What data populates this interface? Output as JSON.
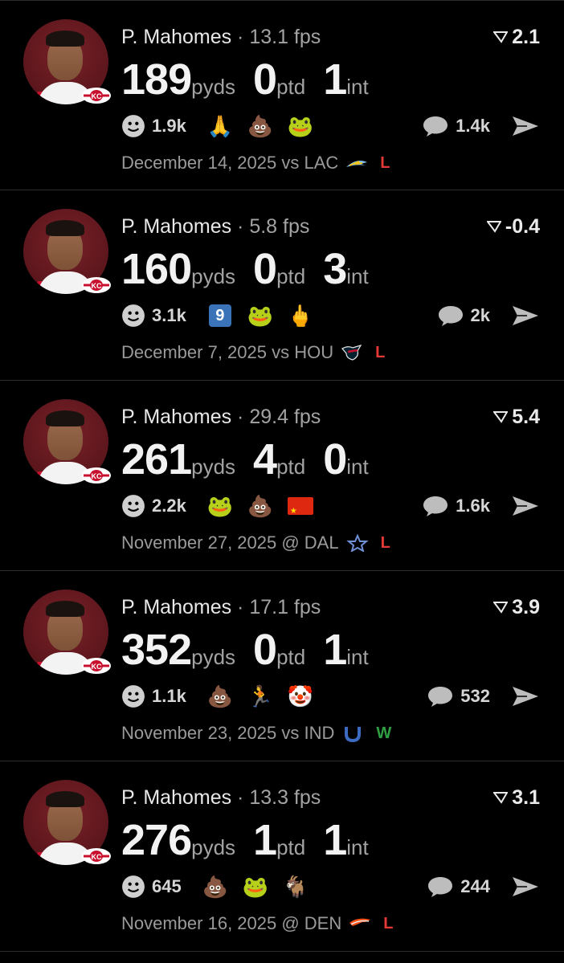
{
  "colors": {
    "background": "#000000",
    "divider": "#2c2c2c",
    "loss": "#e53935",
    "win": "#2ea043",
    "muted_text": "#a3a3a3",
    "chiefs_red": "#c8102e"
  },
  "icons": {
    "reaction": "smiley-icon",
    "comment": "speech-bubble-icon",
    "share": "send-arrow-icon",
    "score": "funnel-icon"
  },
  "posts": [
    {
      "player": "P. Mahomes",
      "separator": " · ",
      "fps": "13.1 fps",
      "score": "2.1",
      "stats": [
        {
          "value": "189",
          "unit": "pyds"
        },
        {
          "value": "0",
          "unit": "ptd"
        },
        {
          "value": "1",
          "unit": "int"
        }
      ],
      "reaction_count": "1.9k",
      "emojis": [
        "🙏",
        "💩",
        "🐸"
      ],
      "comment_count": "1.4k",
      "date_text": "December 14, 2025 vs LAC",
      "team_icon": "chargers-bolt-icon",
      "result": "L"
    },
    {
      "player": "P. Mahomes",
      "separator": " · ",
      "fps": "5.8 fps",
      "score": "-0.4",
      "stats": [
        {
          "value": "160",
          "unit": "pyds"
        },
        {
          "value": "0",
          "unit": "ptd"
        },
        {
          "value": "3",
          "unit": "int"
        }
      ],
      "reaction_count": "3.1k",
      "emojis": [
        "9",
        "🐸",
        "🖕"
      ],
      "comment_count": "2k",
      "date_text": "December 7, 2025 vs HOU",
      "team_icon": "texans-bull-icon",
      "result": "L"
    },
    {
      "player": "P. Mahomes",
      "separator": " · ",
      "fps": "29.4 fps",
      "score": "5.4",
      "stats": [
        {
          "value": "261",
          "unit": "pyds"
        },
        {
          "value": "4",
          "unit": "ptd"
        },
        {
          "value": "0",
          "unit": "int"
        }
      ],
      "reaction_count": "2.2k",
      "emojis": [
        "🐸",
        "💩",
        "china-flag"
      ],
      "comment_count": "1.6k",
      "date_text": "November 27, 2025 @ DAL",
      "team_icon": "cowboys-star-icon",
      "result": "L"
    },
    {
      "player": "P. Mahomes",
      "separator": " · ",
      "fps": "17.1 fps",
      "score": "3.9",
      "stats": [
        {
          "value": "352",
          "unit": "pyds"
        },
        {
          "value": "0",
          "unit": "ptd"
        },
        {
          "value": "1",
          "unit": "int"
        }
      ],
      "reaction_count": "1.1k",
      "emojis": [
        "💩",
        "🏃",
        "🤡"
      ],
      "comment_count": "532",
      "date_text": "November 23, 2025 vs IND",
      "team_icon": "colts-horseshoe-icon",
      "result": "W"
    },
    {
      "player": "P. Mahomes",
      "separator": " · ",
      "fps": "13.3 fps",
      "score": "3.1",
      "stats": [
        {
          "value": "276",
          "unit": "pyds"
        },
        {
          "value": "1",
          "unit": "ptd"
        },
        {
          "value": "1",
          "unit": "int"
        }
      ],
      "reaction_count": "645",
      "emojis": [
        "💩",
        "🐸",
        "🐐"
      ],
      "comment_count": "244",
      "date_text": "November 16, 2025 @ DEN",
      "team_icon": "broncos-horse-icon",
      "result": "L"
    }
  ]
}
